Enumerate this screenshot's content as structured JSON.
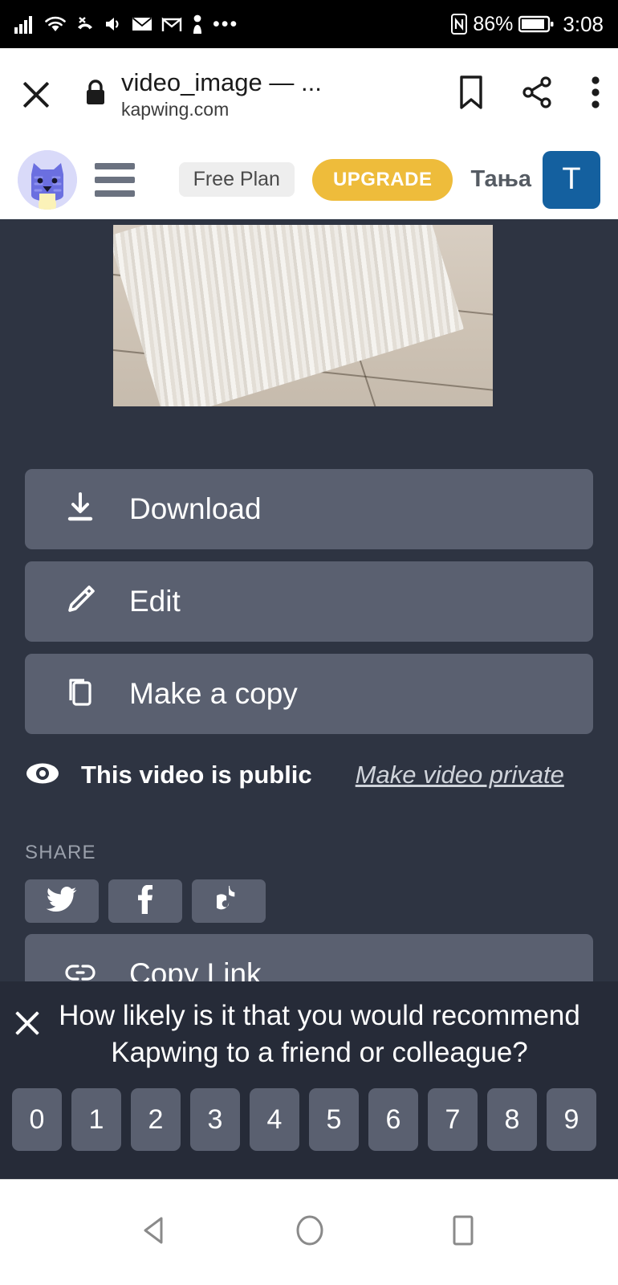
{
  "statusbar": {
    "icons": [
      "signal-bars-icon",
      "wifi-icon",
      "missed-call-icon",
      "volume-icon",
      "mail-icon",
      "gmail-icon",
      "person-icon",
      "more-icon"
    ],
    "nfc_icon": "nfc-icon",
    "battery_percent": "86%",
    "battery_icon": "battery-icon",
    "time": "3:08"
  },
  "custom_tab": {
    "close_icon": "close-icon",
    "lock_icon": "lock-icon",
    "title": "video_image — ...",
    "url": "kapwing.com",
    "bookmark_icon": "bookmark-icon",
    "share_icon": "share-icon",
    "overflow_icon": "overflow-menu-icon"
  },
  "app_header": {
    "logo": "kapwing-cat-logo",
    "menu_icon": "hamburger-menu-icon",
    "plan_badge": "Free Plan",
    "upgrade_label": "UPGRADE",
    "username": "Тања",
    "avatar_initial": "T",
    "avatar_color": "#14609f",
    "upgrade_color": "#eebc3b"
  },
  "main": {
    "video_thumbnail_alt": "video-thumbnail-cat-on-floor",
    "actions": [
      {
        "label": "Download",
        "icon": "download-icon"
      },
      {
        "label": "Edit",
        "icon": "pencil-icon"
      },
      {
        "label": "Make a copy",
        "icon": "copy-icon"
      }
    ],
    "visibility": {
      "icon": "eye-icon",
      "status_text": "This video is public",
      "toggle_link": "Make video private"
    },
    "share": {
      "section_label": "SHARE",
      "buttons": [
        {
          "name": "twitter",
          "icon": "twitter-icon"
        },
        {
          "name": "facebook",
          "icon": "facebook-icon"
        },
        {
          "name": "tiktok",
          "icon": "tiktok-icon"
        }
      ],
      "copy_link_label": "Copy Link",
      "copy_link_icon": "link-icon"
    }
  },
  "survey": {
    "close_icon": "close-icon",
    "question": "How likely is it that you would recommend Kapwing to a friend or colleague?",
    "scores": [
      "0",
      "1",
      "2",
      "3",
      "4",
      "5",
      "6",
      "7",
      "8",
      "9"
    ]
  },
  "navbar": {
    "back_icon": "back-triangle-icon",
    "home_icon": "home-circle-icon",
    "recents_icon": "recents-square-icon"
  },
  "colors": {
    "page_bg": "#2e3442",
    "button_bg": "#5a6070",
    "overlay_bg": "#262b38"
  }
}
